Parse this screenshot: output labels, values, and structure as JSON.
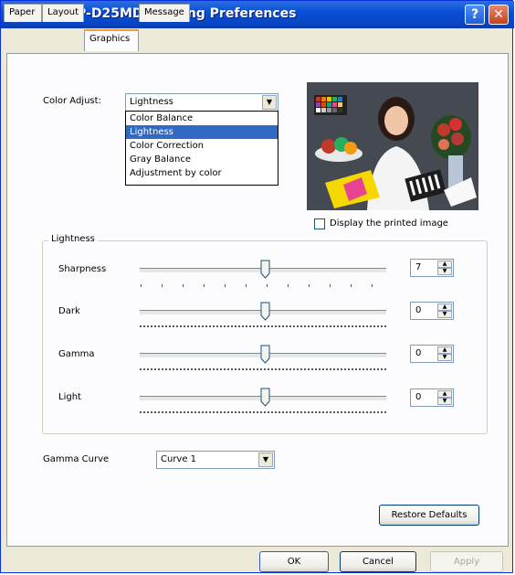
{
  "window": {
    "title": "Sony UP-D25MD Printing Preferences",
    "help_label": "?",
    "close_label": "✕"
  },
  "tabs": [
    {
      "label": "Paper",
      "active": false
    },
    {
      "label": "Layout",
      "active": false
    },
    {
      "label": "Graphics",
      "active": true
    },
    {
      "label": "Message",
      "active": false
    }
  ],
  "color_adjust": {
    "label": "Color Adjust:",
    "selected": "Lightness",
    "options": [
      "Color Balance",
      "Lightness",
      "Color Correction",
      "Gray Balance",
      "Adjustment by color"
    ],
    "highlighted_index": 1
  },
  "preview": {
    "display_printed_image_label": "Display the printed image",
    "checked": false
  },
  "lightness_group": {
    "title": "Lightness",
    "sliders": [
      {
        "label": "Sharpness",
        "value": "7",
        "level": 0.5
      },
      {
        "label": "Dark",
        "value": "0",
        "level": 0.5
      },
      {
        "label": "Gamma",
        "value": "0",
        "level": 0.5
      },
      {
        "label": "Light",
        "value": "0",
        "level": 0.5
      }
    ]
  },
  "gamma_curve": {
    "label": "Gamma Curve",
    "selected": "Curve 1"
  },
  "buttons": {
    "restore_defaults": "Restore Defaults",
    "ok": "OK",
    "cancel": "Cancel",
    "apply": "Apply"
  },
  "colors": {
    "title_bar": "#0a4fd6",
    "selection": "#316ac5",
    "dialog_bg": "#ece9d8",
    "tab_accent": "#f2a030"
  }
}
